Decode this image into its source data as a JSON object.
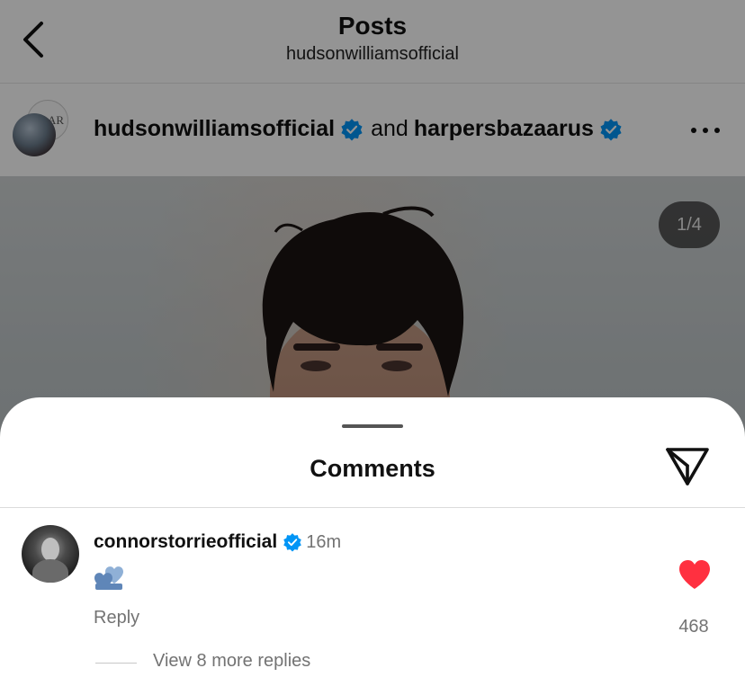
{
  "nav": {
    "title": "Posts",
    "subtitle": "hudsonwilliamsofficial"
  },
  "post": {
    "author_primary": "hudsonwilliamsofficial",
    "connector": "and",
    "author_secondary": "harpersbazaarus",
    "collab_avatar_text": "AR",
    "media_counter": "1/4"
  },
  "comments_sheet": {
    "title": "Comments",
    "comment": {
      "username": "connorstorrieofficial",
      "time": "16m",
      "emoji_icon": "blue-hearts-emoji",
      "reply_label": "Reply",
      "like_count": "468",
      "view_replies_label": "View 8 more replies"
    }
  },
  "colors": {
    "verified_blue": "#0095f6",
    "like_red": "#ff3040",
    "secondary_text": "#737373"
  }
}
